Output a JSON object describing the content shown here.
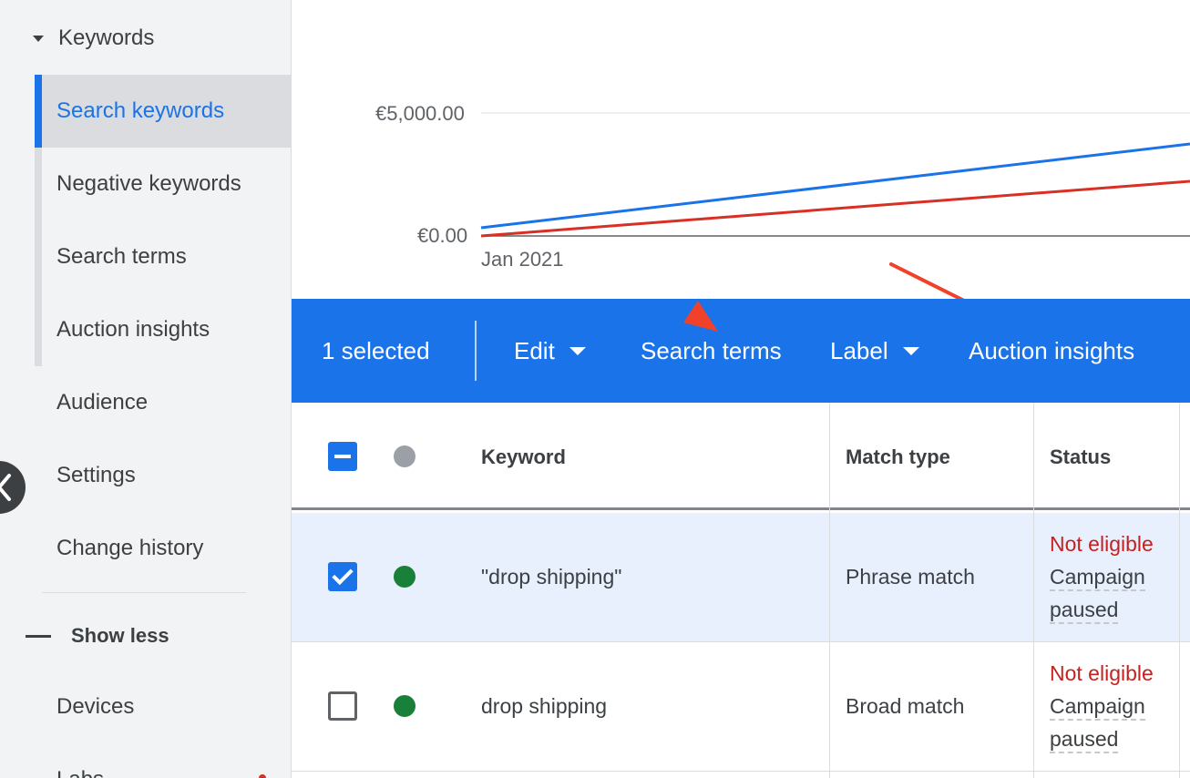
{
  "sidebar": {
    "group_label": "Keywords",
    "sub_items": [
      {
        "label": "Search keywords",
        "active": true
      },
      {
        "label": "Negative keywords"
      },
      {
        "label": "Search terms"
      },
      {
        "label": "Auction insights"
      }
    ],
    "items": [
      {
        "label": "Audience"
      },
      {
        "label": "Settings"
      },
      {
        "label": "Change history"
      }
    ],
    "show_less_label": "Show less",
    "more_items": [
      {
        "label": "Devices"
      },
      {
        "label": "Labs"
      }
    ]
  },
  "chart": {
    "y_ticks": [
      "€5,000.00",
      "€0.00"
    ],
    "x_ticks": [
      "Jan 2021"
    ],
    "series_colors": [
      "#1a73e8",
      "#d93025"
    ]
  },
  "toolbar": {
    "selected_count_label": "1 selected",
    "edit_label": "Edit",
    "search_terms_label": "Search terms",
    "label_label": "Label",
    "auction_insights_label": "Auction insights"
  },
  "table": {
    "headers": {
      "keyword": "Keyword",
      "match_type": "Match type",
      "status": "Status"
    },
    "rows": [
      {
        "keyword": "\"drop shipping\"",
        "match_type": "Phrase match",
        "status": "Not eligible",
        "status_detail_1": "Campaign",
        "status_detail_2": "paused",
        "checked": true
      },
      {
        "keyword": "drop shipping",
        "match_type": "Broad match",
        "status": "Not eligible",
        "status_detail_1": "Campaign",
        "status_detail_2": "paused",
        "checked": false
      }
    ]
  }
}
